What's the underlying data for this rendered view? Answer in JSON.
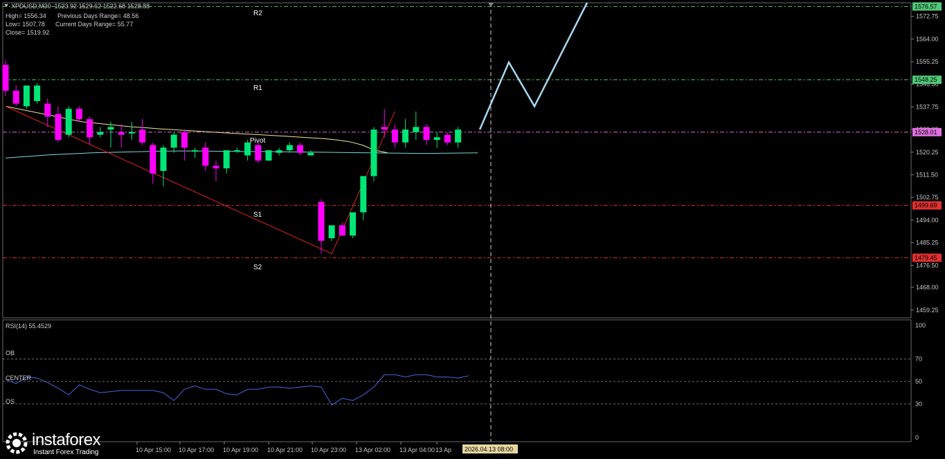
{
  "header": {
    "symbol_line": "XPDUSD,M30  1523.92 1529.62 1522.68 1528.88",
    "high_label": "High= 1556.34",
    "prev_range": "Previous Days Range= 48.56",
    "low_label": "Low= 1507.78",
    "curr_range": "Current Days Range= 55.77",
    "close_label": "Close= 1519.92"
  },
  "levels": {
    "r2": "R2",
    "r1": "R1",
    "pivot": "Pivot",
    "s1": "S1",
    "s2": "S2"
  },
  "rsi": {
    "title": "RSI(14) 55.4529",
    "ob": "OB",
    "center": "CENTER",
    "os": "OS"
  },
  "logo": {
    "name": "instaforex",
    "tagline": "Instant Forex Trading"
  },
  "colors": {
    "bull": "#00e676",
    "bear": "#ff00ff",
    "ma_slow": "#f2e6a0",
    "ma_fast": "#7fd7e0",
    "forecast": "#a8d8f0",
    "trend": "#e02020",
    "rsi": "#4169e1",
    "r_level": "#50c878",
    "s_level": "#e03030",
    "pivot_level": "#e070e0"
  },
  "chart_data": {
    "type": "candlestick",
    "y_axis_ticks": [
      "1572.75",
      "1564.00",
      "1555.25",
      "1546.50",
      "1537.75",
      "1529.00",
      "1520.25",
      "1511.50",
      "1502.75",
      "1494.00",
      "1485.25",
      "1476.50",
      "1468.00",
      "1459.25"
    ],
    "ylim": [
      1456.25,
      1578.0
    ],
    "x_axis_ticks": [
      "10 Apr 15:00",
      "10 Apr 17:00",
      "10 Apr 19:00",
      "10 Apr 21:00",
      "10 Apr 23:00",
      "13 Apr 02:00",
      "13 Apr 04:00",
      "13 Ap"
    ],
    "x_axis_highlight": "2026.04.13 08:00",
    "level_values": [
      {
        "name": "R2",
        "value": 1576.57,
        "label": "1576.57"
      },
      {
        "name": "R1",
        "value": 1548.25,
        "label": "1548.25"
      },
      {
        "name": "Pivot",
        "value": 1528.01,
        "label": "1528.01"
      },
      {
        "name": "S1",
        "value": 1499.69,
        "label": "1499.69"
      },
      {
        "name": "S2",
        "value": 1479.45,
        "label": "1479.45"
      }
    ],
    "candles": [
      {
        "o": 1554,
        "h": 1556,
        "c": 1544,
        "l": 1542
      },
      {
        "o": 1544,
        "h": 1546,
        "c": 1539,
        "l": 1538
      },
      {
        "o": 1538,
        "h": 1546,
        "c": 1546,
        "l": 1537
      },
      {
        "o": 1540,
        "h": 1547,
        "c": 1546,
        "l": 1539
      },
      {
        "o": 1539,
        "h": 1541,
        "c": 1534,
        "l": 1530
      },
      {
        "o": 1535,
        "h": 1538,
        "c": 1525,
        "l": 1524
      },
      {
        "o": 1527,
        "h": 1538,
        "c": 1537,
        "l": 1526
      },
      {
        "o": 1537,
        "h": 1538,
        "c": 1533,
        "l": 1532
      },
      {
        "o": 1533,
        "h": 1534,
        "c": 1526,
        "l": 1523
      },
      {
        "o": 1527,
        "h": 1530,
        "c": 1528,
        "l": 1526
      },
      {
        "o": 1529,
        "h": 1532,
        "c": 1530,
        "l": 1522
      },
      {
        "o": 1528,
        "h": 1531,
        "c": 1527,
        "l": 1522
      },
      {
        "o": 1528,
        "h": 1532,
        "c": 1528,
        "l": 1525
      },
      {
        "o": 1529,
        "h": 1533,
        "c": 1524,
        "l": 1523
      },
      {
        "o": 1523,
        "h": 1524,
        "c": 1512,
        "l": 1508
      },
      {
        "o": 1513,
        "h": 1523,
        "c": 1522,
        "l": 1507
      },
      {
        "o": 1522,
        "h": 1528,
        "c": 1527,
        "l": 1520
      },
      {
        "o": 1528,
        "h": 1529,
        "c": 1522,
        "l": 1517
      },
      {
        "o": 1521,
        "h": 1522,
        "c": 1521,
        "l": 1518
      },
      {
        "o": 1522,
        "h": 1524,
        "c": 1515,
        "l": 1513
      },
      {
        "o": 1515,
        "h": 1517,
        "c": 1514,
        "l": 1509
      },
      {
        "o": 1514,
        "h": 1521,
        "c": 1521,
        "l": 1512
      },
      {
        "o": 1521,
        "h": 1522,
        "c": 1521,
        "l": 1520
      },
      {
        "o": 1519,
        "h": 1525,
        "c": 1524,
        "l": 1517
      },
      {
        "o": 1523,
        "h": 1524,
        "c": 1517,
        "l": 1516
      },
      {
        "o": 1517,
        "h": 1521,
        "c": 1521,
        "l": 1517
      },
      {
        "o": 1520,
        "h": 1522,
        "c": 1521,
        "l": 1519
      },
      {
        "o": 1521,
        "h": 1524,
        "c": 1523,
        "l": 1520
      },
      {
        "o": 1523,
        "h": 1524,
        "c": 1520,
        "l": 1519
      },
      {
        "o": 1519,
        "h": 1521,
        "c": 1520,
        "l": 1519
      },
      {
        "o": 1501,
        "h": 1502,
        "c": 1486,
        "l": 1481
      },
      {
        "o": 1487,
        "h": 1492,
        "c": 1492,
        "l": 1486
      },
      {
        "o": 1492,
        "h": 1493,
        "c": 1488,
        "l": 1488
      },
      {
        "o": 1488,
        "h": 1497,
        "c": 1497,
        "l": 1487
      },
      {
        "o": 1497,
        "h": 1511,
        "c": 1511,
        "l": 1494
      },
      {
        "o": 1511,
        "h": 1530,
        "c": 1529,
        "l": 1509
      },
      {
        "o": 1530,
        "h": 1537,
        "c": 1529,
        "l": 1526
      },
      {
        "o": 1529,
        "h": 1531,
        "c": 1524,
        "l": 1522
      },
      {
        "o": 1524,
        "h": 1533,
        "c": 1529,
        "l": 1522
      },
      {
        "o": 1528,
        "h": 1536,
        "c": 1530,
        "l": 1525
      },
      {
        "o": 1530,
        "h": 1531,
        "c": 1525,
        "l": 1523
      },
      {
        "o": 1525,
        "h": 1528,
        "c": 1526,
        "l": 1522
      },
      {
        "o": 1527,
        "h": 1528,
        "c": 1524,
        "l": 1523
      },
      {
        "o": 1524,
        "h": 1530,
        "c": 1529,
        "l": 1522
      }
    ],
    "ma_slow": [
      1538,
      1537,
      1536,
      1535,
      1534,
      1533,
      1532,
      1531.5,
      1531,
      1530.5,
      1530,
      1529.7,
      1529.3,
      1529,
      1528.7,
      1528.4,
      1528.1,
      1527.8,
      1527.5,
      1527.2,
      1527,
      1526.7,
      1526.4,
      1526.1,
      1525.8,
      1525.5,
      1525,
      1524.3,
      1523,
      1521,
      1520
    ],
    "ma_fast": [
      1518,
      1518.6,
      1519.2,
      1519.6,
      1520,
      1520.2,
      1520.4,
      1520.6,
      1520.7,
      1520.7,
      1520.6,
      1520.5,
      1520.5,
      1520.4,
      1520.3,
      1520.2,
      1520.1,
      1520,
      1519.9,
      1519.8,
      1519.8,
      1519.9,
      1520
    ],
    "forecast_path": [
      1529,
      1555,
      1538,
      1578
    ],
    "trendline": [
      1538,
      1481,
      1536
    ],
    "rsi_values": [
      52,
      48,
      54,
      53,
      49,
      44,
      38,
      47,
      43,
      40,
      41,
      42,
      42,
      42,
      42,
      40,
      33,
      43,
      46,
      43,
      43,
      39,
      38,
      43,
      43,
      45,
      45,
      44,
      45,
      46,
      45,
      29,
      35,
      33,
      38,
      45,
      56,
      56,
      54,
      56,
      56,
      54,
      54,
      53,
      55
    ]
  }
}
